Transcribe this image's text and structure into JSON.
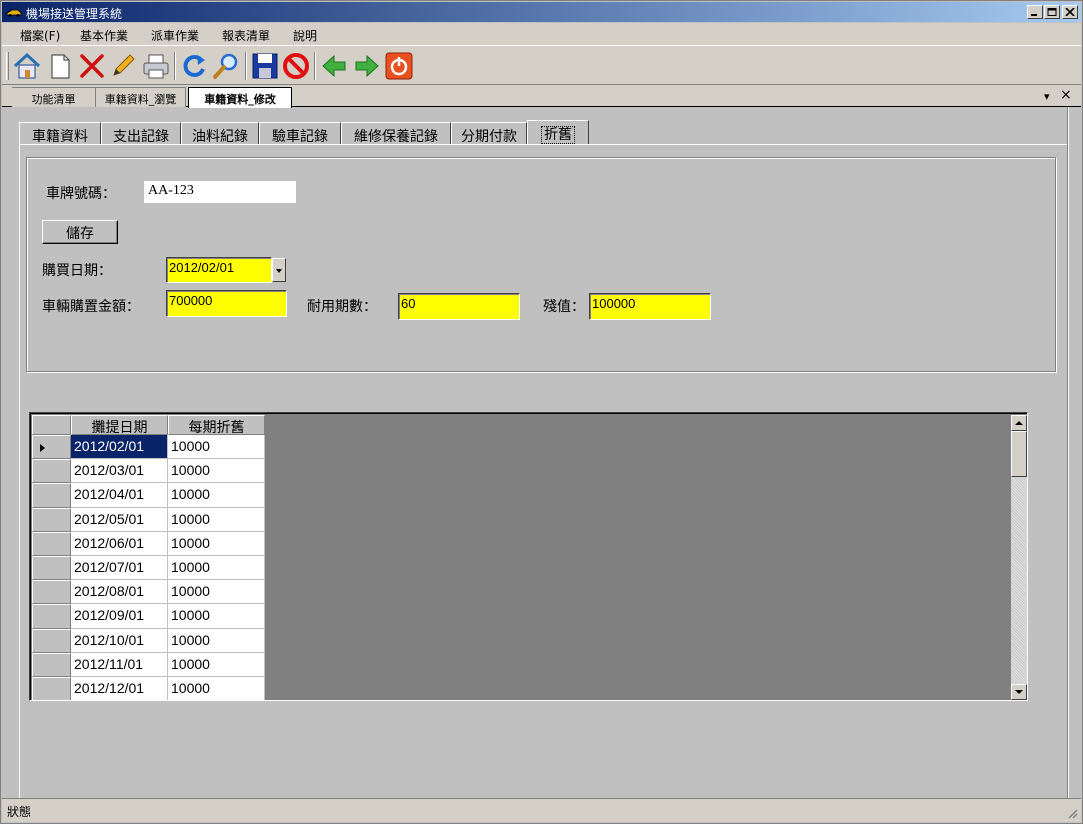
{
  "window": {
    "title": "機場接送管理系統"
  },
  "menu": [
    "檔案(F)",
    "基本作業",
    "派車作業",
    "報表清單",
    "說明"
  ],
  "toolbar_icons": [
    "home-icon",
    "new-document-icon",
    "delete-icon",
    "edit-pencil-icon",
    "print-icon",
    "refresh-icon",
    "search-icon",
    "save-icon",
    "cancel-icon",
    "previous-icon",
    "next-icon",
    "power-icon"
  ],
  "doc_tabs": [
    "功能清單",
    "車籍資料_瀏覽",
    "車籍資料_修改"
  ],
  "doc_tab_controls": {
    "dropdown": "▾",
    "close": "×"
  },
  "sub_tabs": [
    "車籍資料",
    "支出記錄",
    "油料紀錄",
    "驗車記錄",
    "維修保養記錄",
    "分期付款",
    "折舊"
  ],
  "form": {
    "plate_label": "車牌號碼：",
    "plate_value": "AA-123",
    "save_button": "儲存",
    "purchase_date_label": "購買日期：",
    "purchase_date_value": "2012/02/01",
    "purchase_amount_label": "車輛購置金額：",
    "purchase_amount_value": "700000",
    "useful_periods_label": "耐用期數：",
    "useful_periods_value": "60",
    "residual_label": "殘值：",
    "residual_value": "100000"
  },
  "grid": {
    "headers": [
      "攤提日期",
      "每期折舊"
    ],
    "rows": [
      {
        "date": "2012/02/01",
        "amount": "10000"
      },
      {
        "date": "2012/03/01",
        "amount": "10000"
      },
      {
        "date": "2012/04/01",
        "amount": "10000"
      },
      {
        "date": "2012/05/01",
        "amount": "10000"
      },
      {
        "date": "2012/06/01",
        "amount": "10000"
      },
      {
        "date": "2012/07/01",
        "amount": "10000"
      },
      {
        "date": "2012/08/01",
        "amount": "10000"
      },
      {
        "date": "2012/09/01",
        "amount": "10000"
      },
      {
        "date": "2012/10/01",
        "amount": "10000"
      },
      {
        "date": "2012/11/01",
        "amount": "10000"
      },
      {
        "date": "2012/12/01",
        "amount": "10000"
      }
    ]
  },
  "status": {
    "text": "狀態"
  },
  "colors": {
    "title_gradient_start": "#0a246a",
    "input_highlight": "#ffff00",
    "selection": "#0a246a",
    "grid_background": "#808080"
  }
}
